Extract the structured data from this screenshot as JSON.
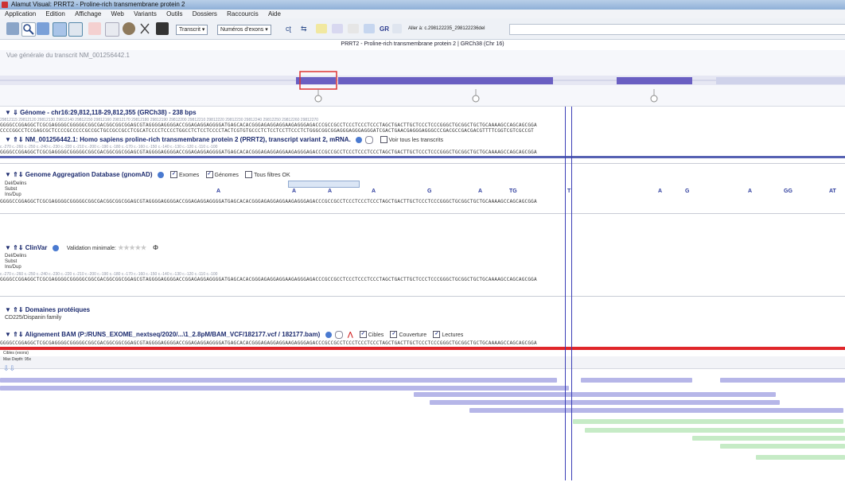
{
  "window": {
    "title": "Alamut Visual: PRRT2 - Proline-rich transmembrane protein 2"
  },
  "menu": [
    "Application",
    "Edition",
    "Affichage",
    "Web",
    "Variants",
    "Outils",
    "Dossiers",
    "Raccourcis",
    "Aide"
  ],
  "toolbar": {
    "transcript_combo": "Transcrit",
    "exon_combo": "Numéros d'exons",
    "gr_label": "GR",
    "goto_label": "Aller à: c.298122235_298122236del",
    "goto_value": ""
  },
  "gene_header": "PRRT2 - Proline-rich transmembrane protein 2 | GRCh38 (Chr 16)",
  "overview": {
    "label": "Vue générale du transcrit NM_001256442.1"
  },
  "genome": {
    "title": "Génome - chr16:29,812,118-29,812,355 (GRCh38) - 238 bps",
    "ruler": "29812115        29812120        29812130        29812140        29812150        29812160        29812170        29812180        29812190        29812200        29812210        29812220        29812230        29812240        29812250        29812260        29812270",
    "seq1": "GGGGCCGGAGGCTCGCGAGGGGCGGGGGCGGCGACGGCGGCGGAGCGTAGGGGAGGGGACCGGAGAGGAGGGGATGAGCACACGGGAGAGGAGGAAGAGGGAGACCCGCCGCCTCCCTCCCTCCCTAGCTGACTTGCTCCCTCCCGGGCTGCGGCTGCTGCAAAAGCCAGCAGCGGA",
    "seq2": "CCCCGGCCTCCGAGCGCTCCCCGCCCCCGCCGCTGCCGCCGCCTCGCATCCCCTCCCCTGGCCTCTCCTCCCCTACTCGTGTGCCCTCTCCTCCTTCCCTCTGGGCGGCGGAGGGAGGGAGGGATCGACTGAACGAGGGAGGGCCCGACGCCGACGACGTTTTCGGTCGTCGCCGT"
  },
  "transcript": {
    "title": "NM_001256442.1: Homo sapiens proline-rich transmembrane protein 2 (PRRT2), transcript variant 2, mRNA.",
    "show_all": "Voir tous les transcrits",
    "ruler": "c.-270     c.-260     c.-250     c.-240     c.-230     c.-220     c.-210     c.-200     c.-190     c.-180     c.-170     c.-160     c.-150     c.-140     c.-130     c.-120     c.-110     c.-100",
    "seq": "GGGGCCGGAGGCTCGCGAGGGGCGGGGGCGGCGACGGCGGCGGAGCGTAGGGGAGGGGACCGGAGAGGAGGGGATGAGCACACGGGAGAGGAGGAAGAGGGAGACCCGCCGCCTCCCTCCCTCCCTAGCTGACTTGCTCCCTCCCGGGCTGCGGCTGCTGCAAAAGCCAGCAGCGGA"
  },
  "gnomad": {
    "title": "Genome Aggregation Database (gnomAD)",
    "exomes": "Exomes",
    "genomes": "Génomes",
    "all_filters": "Tous filtres OK",
    "row_labels": [
      "Del/Delins",
      "Subst",
      "Ins/Dup"
    ],
    "markers": [
      "A",
      "A",
      "A",
      "A",
      "G",
      "A",
      "TG",
      "T",
      "A",
      "G",
      "A",
      "GG",
      "AT"
    ],
    "seq": "GGGGCCGGAGGCTCGCGAGGGGCGGGGGCGGCGACGGCGGCGGAGCGTAGGGGAGGGGACCGGAGAGGAGGGGATGAGCACACGGGAGAGGAGGAAGAGGGAGACCCGCCGCCTCCCTCCCTCCCTAGCTGACTTGCTCCCTCCCGGGCTGCGGCTGCTGCAAAAGCCAGCAGCGGA"
  },
  "clinvar": {
    "title": "ClinVar",
    "validation": "Validation minimale:",
    "row_labels": [
      "Del/Delins",
      "Subst",
      "Ins/Dup"
    ],
    "ruler": "c.-270     c.-260     c.-250     c.-240     c.-230     c.-220     c.-210     c.-200     c.-190     c.-180     c.-170     c.-160     c.-150     c.-140     c.-130     c.-120     c.-110     c.-100",
    "seq": "GGGGCCGGAGGCTCGCGAGGGGCGGGGGCGGCGACGGCGGCGGAGCGTAGGGGAGGGGACCGGAGAGGAGGGGATGAGCACACGGGAGAGGAGGAAGAGGGAGACCCGCCGCCTCCCTCCCTCCCTAGCTGACTTGCTCCCTCCCGGGCTGCGGCTGCTGCAAAAGCCAGCAGCGGA"
  },
  "domains": {
    "title": "Domaines protéiques",
    "family": "CD225/Dispanin family"
  },
  "bam": {
    "title": "Alignement BAM (P:/RUNS_EXOME_nextseq/2020/...\\1_2.8pM/BAM_VCF/182177.vcf / 182177.bam)",
    "cibles": "Cibles",
    "couverture": "Couverture",
    "lectures": "Lectures",
    "cibles_label": "Cibles (exons)",
    "max_depth": "Max Depth: 95x",
    "seq": "GGGGCCGGAGGCTCGCGAGGGGCGGGGGCGGCGACGGCGGCGGAGCGTAGGGGAGGGGACCGGAGAGGAGGGGATGAGCACACGGGAGAGGAGGAAGAGGGAGACCCGCCGCCTCCCTCCCTCCCTAGCTGACTTGCTCCCTCCCGGGCTGCGGCTGCTGCAAAAGCCAGCAGCGGA",
    "reads": [
      {
        "color": "purple"
      },
      {
        "color": "purple"
      },
      {
        "color": "purple"
      },
      {
        "color": "purple"
      },
      {
        "color": "purple"
      },
      {
        "color": "purple"
      },
      {
        "color": "purple"
      },
      {
        "color": "green"
      },
      {
        "color": "green"
      },
      {
        "color": "green"
      },
      {
        "color": "green"
      },
      {
        "color": "green"
      }
    ]
  },
  "colors": {
    "accent": "#5762b3",
    "cibles_bar": "#e0262b",
    "read_purple": "#b6b6e8",
    "read_green": "#c6ebc6"
  }
}
